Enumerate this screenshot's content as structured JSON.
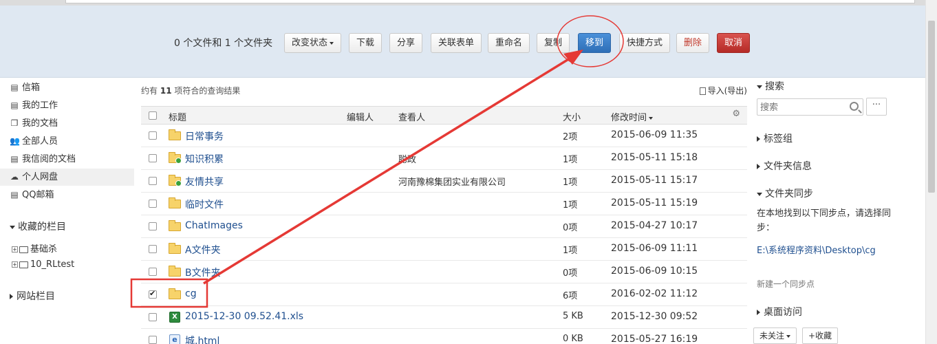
{
  "toolbar": {
    "selection_text": "0 个文件和 1 个文件夹",
    "buttons": {
      "change_status": "改变状态",
      "download": "下载",
      "share": "分享",
      "link_form": "关联表单",
      "rename": "重命名",
      "copy": "复制",
      "move_to": "移到",
      "shortcut": "快捷方式",
      "delete": "删除",
      "cancel": "取消"
    }
  },
  "sidebar": {
    "items": [
      {
        "label": "信箱",
        "icon": "inbox-icon"
      },
      {
        "label": "我的工作",
        "icon": "tasks-icon"
      },
      {
        "label": "我的文档",
        "icon": "documents-icon"
      },
      {
        "label": "全部人员",
        "icon": "people-icon"
      },
      {
        "label": "我信阅的文档",
        "icon": "subscribed-icon"
      },
      {
        "label": "个人网盘",
        "icon": "cloud-icon",
        "active": true
      },
      {
        "label": "QQ邮箱",
        "icon": "mail-icon"
      }
    ],
    "favorites_label": "收藏的栏目",
    "tree": [
      "基础杀",
      "10_RLtest"
    ],
    "site_label": "网站栏目"
  },
  "main": {
    "result_prefix": "约有",
    "result_count": "11",
    "result_suffix": "项符合的查询结果",
    "import_export": "导入(导出)",
    "columns": {
      "title": "标题",
      "editor": "编辑人",
      "viewer": "查看人",
      "size": "大小",
      "mtime": "修改时间"
    },
    "rows": [
      {
        "name": "日常事务",
        "viewer": "",
        "size": "2项",
        "mtime": "2015-06-09 11:35",
        "type": "folder",
        "checked": false
      },
      {
        "name": "知识积累",
        "viewer": "聪政",
        "size": "1项",
        "mtime": "2015-05-11 15:18",
        "type": "folder-shared",
        "checked": false
      },
      {
        "name": "友情共享",
        "viewer": "河南豫棉集团实业有限公司",
        "size": "1项",
        "mtime": "2015-05-11 15:17",
        "type": "folder-shared",
        "checked": false
      },
      {
        "name": "临时文件",
        "viewer": "",
        "size": "1项",
        "mtime": "2015-05-11 15:19",
        "type": "folder",
        "checked": false
      },
      {
        "name": "ChatImages",
        "viewer": "",
        "size": "0项",
        "mtime": "2015-04-27 10:17",
        "type": "folder",
        "checked": false
      },
      {
        "name": "A文件夹",
        "viewer": "",
        "size": "1项",
        "mtime": "2015-06-09 11:11",
        "type": "folder",
        "checked": false
      },
      {
        "name": "B文件夹",
        "viewer": "",
        "size": "0项",
        "mtime": "2015-06-09 10:15",
        "type": "folder",
        "checked": false
      },
      {
        "name": "cg",
        "viewer": "",
        "size": "6项",
        "mtime": "2016-02-02 11:12",
        "type": "folder",
        "checked": true
      },
      {
        "name": "2015-12-30 09.52.41.xls",
        "viewer": "",
        "size": "5 KB",
        "mtime": "2015-12-30 09:52",
        "type": "xls",
        "checked": false
      },
      {
        "name": "城.html",
        "viewer": "",
        "size": "0 KB",
        "mtime": "2015-05-27 16:19",
        "type": "html",
        "checked": false
      }
    ]
  },
  "rpanel": {
    "search_label": "搜索",
    "search_placeholder": "搜索",
    "more": "···",
    "tag_group": "标签组",
    "folder_info": "文件夹信息",
    "folder_sync": "文件夹同步",
    "sync_text": "在本地找到以下同步点，请选择同步：",
    "sync_path": "E:\\系统程序资料\\Desktop\\cg",
    "new_sync": "新建一个同步点",
    "desktop_access": "桌面访问",
    "unfollow": "未关注",
    "favorite": "+收藏"
  },
  "colors": {
    "toolbar_bg": "#dfe8f2",
    "primary": "#2e6fb7",
    "danger": "#c9302c",
    "annotation_red": "#e53935",
    "link": "#1f4f8f"
  }
}
